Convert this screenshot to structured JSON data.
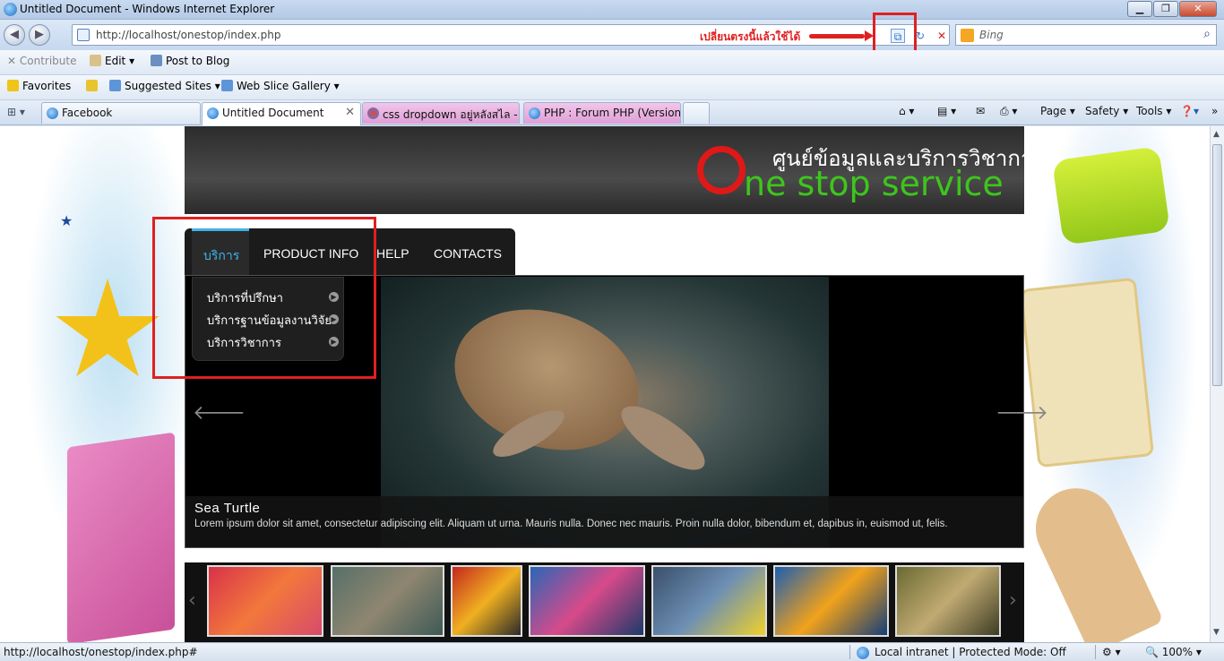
{
  "window": {
    "title": "Untitled Document - Windows Internet Explorer",
    "minimize": "▁",
    "maximize": "❐",
    "close": "✕"
  },
  "address": {
    "url": "http://localhost/onestop/index.php",
    "annotation": "เปลี่ยนตรงนี้แล้วใช้ได้"
  },
  "search": {
    "placeholder": "Bing"
  },
  "toolbar1": {
    "contribute": "Contribute",
    "edit": "Edit",
    "post_to_blog": "Post to Blog"
  },
  "favorites_bar": {
    "favorites": "Favorites",
    "suggested_sites": "Suggested Sites",
    "web_slice_gallery": "Web Slice Gallery"
  },
  "tabs": [
    {
      "label": "Facebook"
    },
    {
      "label": "Untitled Document"
    },
    {
      "label": "css dropdown อยู่หลังสไล - ..."
    },
    {
      "label": "PHP : Forum PHP (Version..."
    }
  ],
  "command_bar": {
    "page": "Page",
    "safety": "Safety",
    "tools": "Tools"
  },
  "site": {
    "logo_thai": "ศูนย์ข้อมูลและบริการวิชาการ",
    "logo_english": "ne stop service",
    "menu": [
      {
        "label": "บริการ"
      },
      {
        "label": "PRODUCT INFO"
      },
      {
        "label": "HELP"
      },
      {
        "label": "CONTACTS"
      }
    ],
    "dropdown": [
      {
        "label": "บริการที่ปรึกษา"
      },
      {
        "label": "บริการฐานข้อมูลงานวิจัย"
      },
      {
        "label": "บริการวิชาการ"
      }
    ],
    "slide": {
      "title": "Sea Turtle",
      "text": "Lorem ipsum dolor sit amet, consectetur adipiscing elit. Aliquam ut urna. Mauris nulla. Donec nec mauris. Proin nulla dolor, bibendum et, dapibus in, euismod ut, felis."
    }
  },
  "status": {
    "url": "http://localhost/onestop/index.php#",
    "zone": "Local intranet | Protected Mode: Off",
    "zoom": "100%"
  }
}
